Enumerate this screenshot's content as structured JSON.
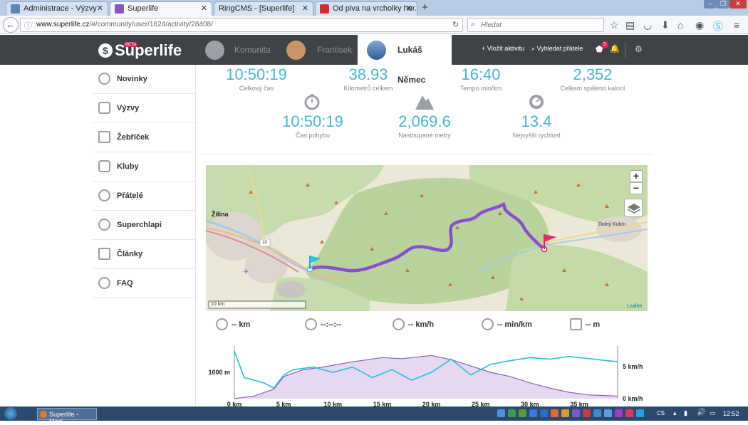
{
  "browser": {
    "tabs": [
      {
        "title": "Administrace - Výzvy",
        "color": "#5b87b8"
      },
      {
        "title": "Superlife",
        "color": "#8b54c4"
      },
      {
        "title": "RingCMS - [Superlife]",
        "color": "#8ea6c4"
      },
      {
        "title": "Od piva na vrcholky hor. Se...",
        "color": "#d32f2f"
      }
    ],
    "url_domain": "www.superlife.cz",
    "url_path": "/#/community/user/1624/activity/28408/",
    "search_placeholder": "Hledat"
  },
  "site": {
    "logo": "Superlife",
    "beta": "BETA",
    "nav": {
      "community": "Komunita",
      "friend": "Frantisek",
      "user": "Lukáš Němec"
    },
    "add_activity": "Vložit aktivitu",
    "find_friends": "Vyhledat přátele",
    "notif_count": "5"
  },
  "sidebar": {
    "items": [
      {
        "label": "Novinky"
      },
      {
        "label": "Výzvy"
      },
      {
        "label": "Žebříček"
      },
      {
        "label": "Kluby"
      },
      {
        "label": "Přátelé"
      },
      {
        "label": "Superchlapi"
      },
      {
        "label": "Články"
      },
      {
        "label": "FAQ"
      }
    ]
  },
  "stats": {
    "total_time": {
      "value": "10:50:19",
      "label": "Celkový čas"
    },
    "km": {
      "value": "38.93",
      "label": "Kilometrů celkem"
    },
    "pace": {
      "value": "16:40",
      "label": "Tempo min/km"
    },
    "calories": {
      "value": "2,352",
      "label": "Celkem spáleno kalorií"
    },
    "moving_time": {
      "value": "10:50:19",
      "label": "Čas pohybu"
    },
    "ascent": {
      "value": "2,069.6",
      "label": "Nastoupané metry"
    },
    "max_speed": {
      "value": "13.4",
      "label": "Nejvyšší rychlost"
    }
  },
  "map": {
    "city_left": "Žilina",
    "city_right": "Dolný Kubín",
    "road": "18",
    "scale": "10 km",
    "attribution": "Leaflet",
    "zoom_in": "+",
    "zoom_out": "−"
  },
  "metrics": {
    "distance": "-- km",
    "time": "--:--:--",
    "speed": "-- km/h",
    "pace": "-- min/km",
    "elevation": "-- m"
  },
  "chart_data": {
    "type": "line",
    "x_ticks": [
      "0 km",
      "5 km",
      "10 km",
      "15 km",
      "20 km",
      "25 km",
      "30 km",
      "35 km"
    ],
    "y_left_label": "1000 m",
    "y_right_labels": [
      "5 km/h",
      "0 km/h"
    ],
    "series": [
      {
        "values_km": [
          0,
          2,
          4,
          5,
          7,
          9,
          12,
          15,
          17,
          20,
          22,
          24,
          26,
          28,
          30,
          32,
          34,
          36,
          38.9
        ],
        "elevation_rel": [
          0.0,
          0.05,
          0.18,
          0.42,
          0.55,
          0.6,
          0.7,
          0.78,
          0.76,
          0.82,
          0.74,
          0.62,
          0.5,
          0.42,
          0.3,
          0.2,
          0.12,
          0.07,
          0.05
        ]
      },
      {
        "values_km": [
          0,
          1,
          2,
          3,
          4,
          5,
          6,
          8,
          10,
          12,
          14,
          16,
          18,
          20,
          22,
          24,
          26,
          28,
          30,
          32,
          34,
          36,
          38.9
        ],
        "speed_rel": [
          0.9,
          0.4,
          0.35,
          0.3,
          0.2,
          0.45,
          0.55,
          0.6,
          0.5,
          0.6,
          0.4,
          0.55,
          0.35,
          0.5,
          0.75,
          0.45,
          0.65,
          0.72,
          0.78,
          0.75,
          0.8,
          0.76,
          0.7
        ]
      }
    ],
    "colors": {
      "elevation_fill": "#e6d8f2",
      "elevation_line": "#8a5fb5",
      "speed": "#24c1d3"
    }
  },
  "taskbar": {
    "app": "Superlife - Mozi...",
    "lang": "CS",
    "clock": "12:52"
  }
}
